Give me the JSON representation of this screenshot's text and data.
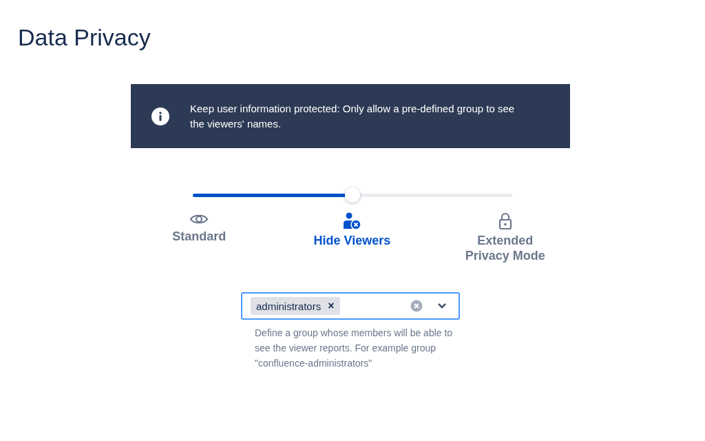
{
  "title": "Data Privacy",
  "banner": {
    "text": "Keep user information protected: Only allow a pre-defined group to see the viewers' names."
  },
  "privacy_slider": {
    "level": 0.5
  },
  "options": [
    {
      "kind": "eye",
      "label": "Standard",
      "selected": false
    },
    {
      "kind": "user-blocked",
      "label": "Hide Viewers",
      "selected": true
    },
    {
      "kind": "lock",
      "label": "Extended Privacy Mode",
      "selected": false
    }
  ],
  "group_select": {
    "tags": [
      {
        "label": "administrators",
        "remove": "×"
      }
    ]
  },
  "help_text": "Define a group whose members will be able to see the viewer reports. For example group \"confluence-administrators\""
}
